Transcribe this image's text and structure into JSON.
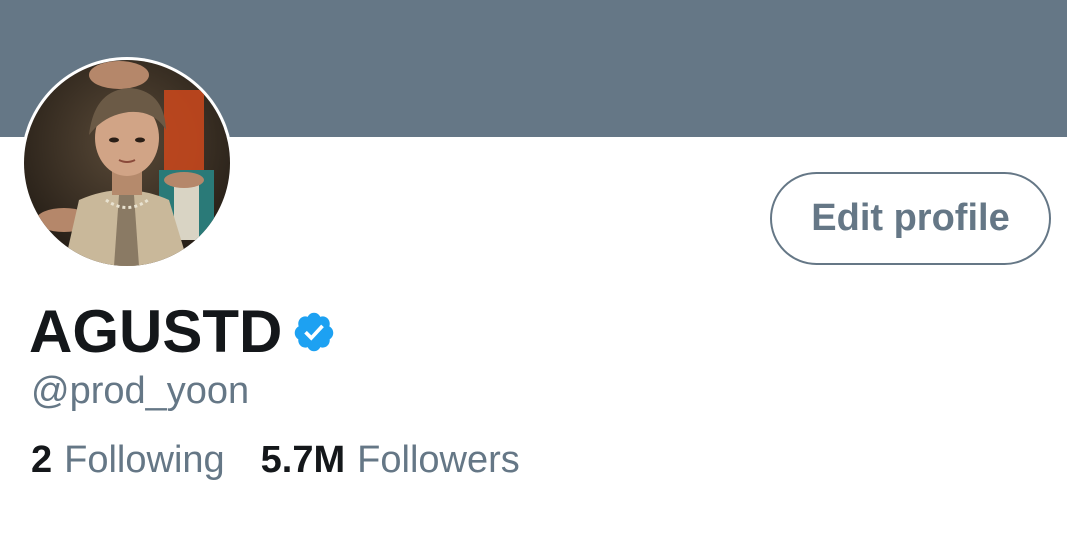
{
  "profile": {
    "display_name": "AGUSTD",
    "handle": "@prod_yoon",
    "verified": true,
    "edit_button_label": "Edit profile"
  },
  "stats": {
    "following_count": "2",
    "following_label": "Following",
    "followers_count": "5.7M",
    "followers_label": "Followers"
  },
  "colors": {
    "banner": "#657786",
    "verified_badge": "#1da1f2",
    "primary_text": "#14171a",
    "secondary_text": "#657786"
  },
  "icons": {
    "verified": "verified-badge-icon"
  }
}
